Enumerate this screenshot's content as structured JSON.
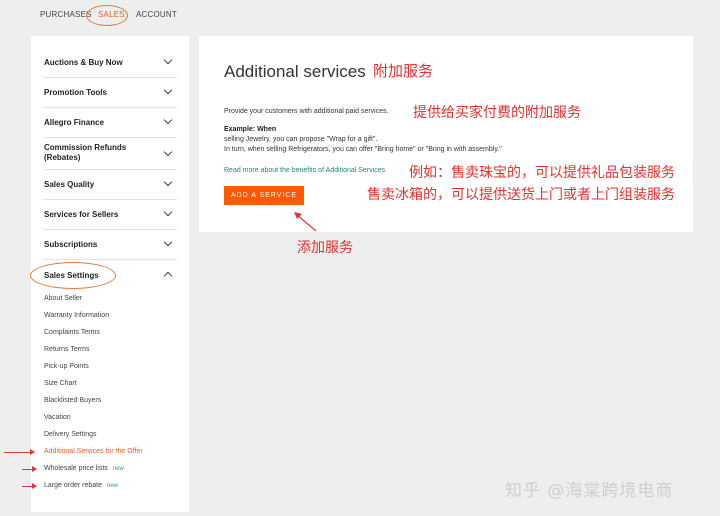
{
  "topnav": {
    "tabs": [
      "PURCHASES",
      "SALES",
      "ACCOUNT"
    ]
  },
  "sidebar": {
    "items": [
      {
        "label": "Auctions & Buy Now"
      },
      {
        "label": "Promotion Tools"
      },
      {
        "label": "Allegro Finance"
      },
      {
        "label": "Commission Refunds (Rebates)"
      },
      {
        "label": "Sales Quality"
      },
      {
        "label": "Services for Sellers"
      },
      {
        "label": "Subscriptions"
      },
      {
        "label": "Sales Settings"
      }
    ],
    "sub_items": [
      {
        "label": "About Seller"
      },
      {
        "label": "Warranty Information"
      },
      {
        "label": "Complaints Terms"
      },
      {
        "label": "Returns Terms"
      },
      {
        "label": "Pick-up Points"
      },
      {
        "label": "Size Chart"
      },
      {
        "label": "Blacklisted Buyers"
      },
      {
        "label": "Vacation"
      },
      {
        "label": "Delivery Settings"
      },
      {
        "label": "Additional Services for the Offer"
      },
      {
        "label": "Wholesale price lists",
        "badge": "new"
      },
      {
        "label": "Large order rebate",
        "badge": "new"
      }
    ]
  },
  "main": {
    "title": "Additional services",
    "title_cn": "附加服务",
    "description": "Provide your customers with additional paid services.",
    "description_cn": "提供给买家付费的附加服务",
    "example_heading": "Example: When",
    "example_lines": [
      "selling Jewelry, you can propose \"Wrap for a gift\".",
      "In turn, when selling Refrigerators, you can offer \"Bring home\" or \"Bring in with assembly.\""
    ],
    "link": "Read more about the benefits of Additional Services",
    "example_cn_1": "例如：售卖珠宝的，可以提供礼品包装服务",
    "example_cn_2": "售卖冰箱的，可以提供送货上门或者上门组装服务",
    "button": "ADD A SERVICE",
    "button_cn": "添加服务"
  },
  "watermark": "知乎 @海棠跨境电商",
  "colors": {
    "accent": "#ff5a00",
    "annotation": "#e0322f",
    "link": "#1a8a7c",
    "badge": "#2aa36b"
  }
}
